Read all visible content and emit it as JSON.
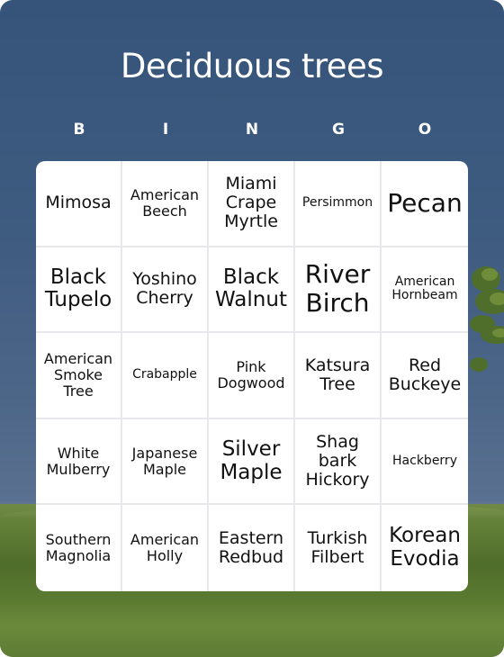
{
  "title": "Deciduous trees",
  "header_letters": [
    "B",
    "I",
    "N",
    "G",
    "O"
  ],
  "colors": {
    "sky": "#3e5b80",
    "grass": "#5f7d35",
    "card_bg": "#ffffff",
    "grid_line": "#e6e8eb",
    "text": "#111111",
    "title_text": "#ffffff"
  },
  "board": [
    [
      "Mimosa",
      "American Beech",
      "Miami Crape Myrtle",
      "Persimmon",
      "Pecan"
    ],
    [
      "Black Tupelo",
      "Yoshino Cherry",
      "Black Walnut",
      "River Birch",
      "American Hornbeam"
    ],
    [
      "American Smoke Tree",
      "Crabapple",
      "Pink Dogwood",
      "Katsura Tree",
      "Red Buckeye"
    ],
    [
      "White Mulberry",
      "Japanese Maple",
      "Silver Maple",
      "Shag bark Hickory",
      "Hackberry"
    ],
    [
      "Southern Magnolia",
      "American Holly",
      "Eastern Redbud",
      "Turkish Filbert",
      "Korean Evodia"
    ]
  ]
}
